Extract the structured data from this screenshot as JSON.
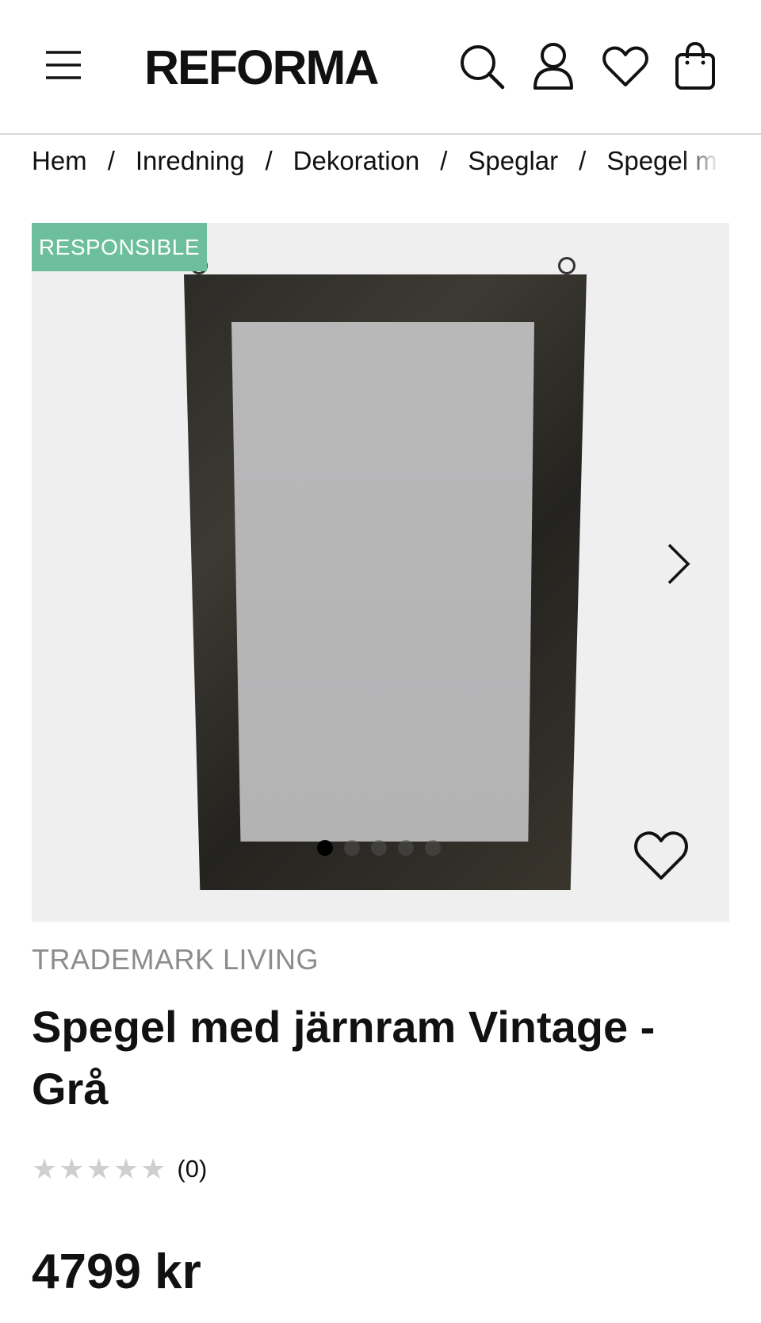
{
  "header": {
    "logo": "REFORMA",
    "icons": [
      "menu-icon",
      "search-icon",
      "account-icon",
      "heart-icon",
      "bag-icon"
    ]
  },
  "breadcrumb": [
    "Hem",
    "Inredning",
    "Dekoration",
    "Speglar",
    "Spegel med järnram Vintage - Grå"
  ],
  "breadcrumb_separator": "/",
  "gallery": {
    "badge": "RESPONSIBLE",
    "badge_color": "#6cbf9a",
    "image_count": 5,
    "active_index": 0
  },
  "product": {
    "brand": "TRADEMARK LIVING",
    "title": "Spegel med järnram Vintage - Grå",
    "rating_stars": 0,
    "rating_max": 5,
    "review_count": "(0)",
    "price": "4799 kr"
  }
}
